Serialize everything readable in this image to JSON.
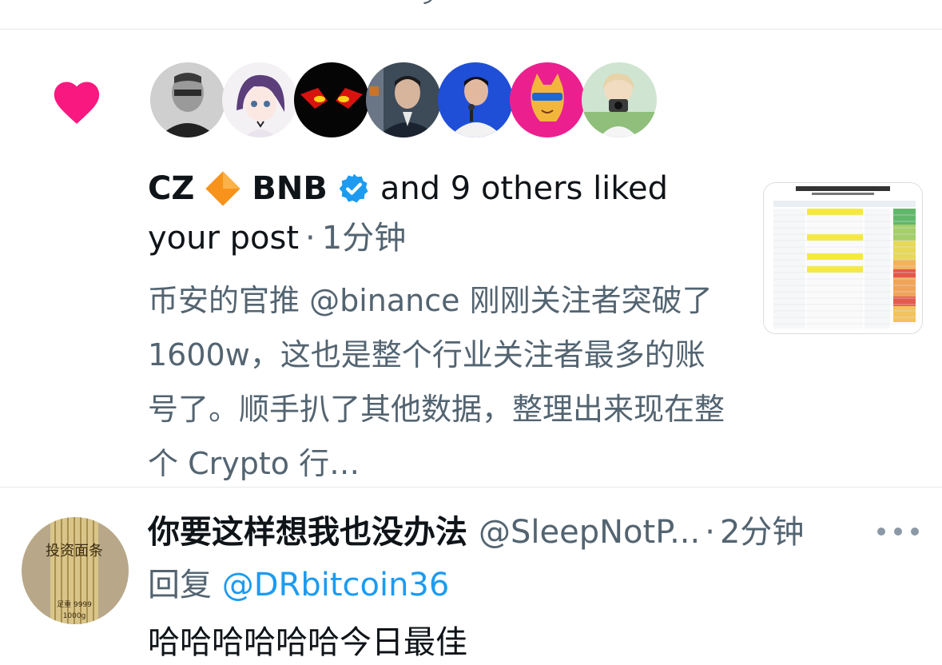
{
  "notification": {
    "type": "like",
    "actor_name": "CZ",
    "actor_name_suffix": "BNB",
    "liked_text": "and 9 others liked",
    "liked_text_2": "your post",
    "separator": "·",
    "time": "1分钟",
    "post_excerpt": "币安的官推 @binance 刚刚关注者突破了 1600w，这也是整个行业关注者最多的账号了。顺手扒了其他数据，整理出来现在整个 Crypto 行…",
    "avatars": [
      "avatar-cz",
      "avatar-anime-girl",
      "avatar-red-eyes",
      "avatar-man-suit",
      "avatar-man-mic",
      "avatar-pink-cat",
      "avatar-photographer"
    ],
    "colors": {
      "heart": "#f91880",
      "verified": "#1d9bf0",
      "diamond": "#f7931a"
    }
  },
  "reply": {
    "display_name": "你要这样想我也没办法",
    "handle": "@SleepNotP...",
    "separator": "·",
    "time": "2分钟",
    "reply_prefix": "回复",
    "reply_target": "@DRbitcoin36",
    "text": "哈哈哈哈哈哈今日最佳",
    "avatar_text": "投资面条",
    "avatar_subtext": "足重 9999",
    "avatar_weight": "1000g"
  }
}
